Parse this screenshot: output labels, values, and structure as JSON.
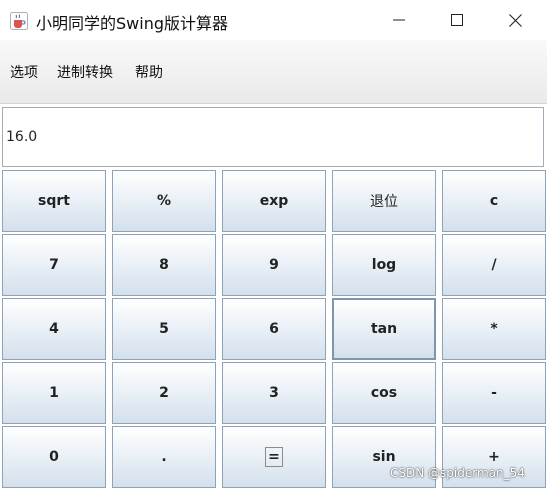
{
  "window": {
    "title": "小明同学的Swing版计算器",
    "icon": "java-coffee-cup-icon"
  },
  "window_controls": {
    "minimize_icon": "minimize-icon",
    "maximize_icon": "maximize-icon",
    "close_icon": "close-icon"
  },
  "menu": {
    "items": [
      {
        "label": "选项"
      },
      {
        "label": "进制转换"
      },
      {
        "label": "帮助"
      }
    ]
  },
  "display": {
    "value": "16.0"
  },
  "keys": [
    [
      "sqrt",
      "%",
      "exp",
      "退位",
      "c"
    ],
    [
      "7",
      "8",
      "9",
      "log",
      "/"
    ],
    [
      "4",
      "5",
      "6",
      "tan",
      "*"
    ],
    [
      "1",
      "2",
      "3",
      "cos",
      "-"
    ],
    [
      "0",
      ".",
      "=",
      "sin",
      "+"
    ]
  ],
  "watermark": "CSDN @spiderman_54"
}
